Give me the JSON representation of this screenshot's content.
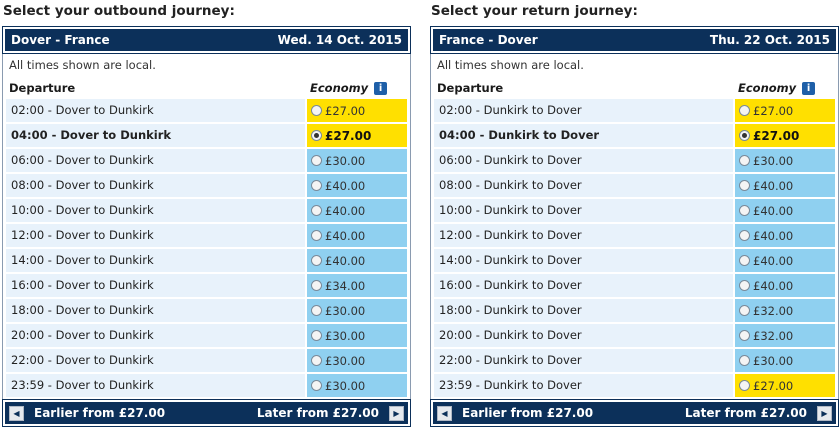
{
  "outbound": {
    "title": "Select your outbound journey:",
    "route": "Dover - France",
    "date": "Wed. 14 Oct. 2015",
    "note": "All times shown are local.",
    "col_departure": "Departure",
    "col_economy": "Economy",
    "rows": [
      {
        "time": "02:00 - Dover to Dunkirk",
        "price": "£27.00",
        "cheapest": true,
        "selected": false
      },
      {
        "time": "04:00 - Dover to Dunkirk",
        "price": "£27.00",
        "cheapest": true,
        "selected": true
      },
      {
        "time": "06:00 - Dover to Dunkirk",
        "price": "£30.00",
        "cheapest": false,
        "selected": false
      },
      {
        "time": "08:00 - Dover to Dunkirk",
        "price": "£40.00",
        "cheapest": false,
        "selected": false
      },
      {
        "time": "10:00 - Dover to Dunkirk",
        "price": "£40.00",
        "cheapest": false,
        "selected": false
      },
      {
        "time": "12:00 - Dover to Dunkirk",
        "price": "£40.00",
        "cheapest": false,
        "selected": false
      },
      {
        "time": "14:00 - Dover to Dunkirk",
        "price": "£40.00",
        "cheapest": false,
        "selected": false
      },
      {
        "time": "16:00 - Dover to Dunkirk",
        "price": "£34.00",
        "cheapest": false,
        "selected": false
      },
      {
        "time": "18:00 - Dover to Dunkirk",
        "price": "£30.00",
        "cheapest": false,
        "selected": false
      },
      {
        "time": "20:00 - Dover to Dunkirk",
        "price": "£30.00",
        "cheapest": false,
        "selected": false
      },
      {
        "time": "22:00 - Dover to Dunkirk",
        "price": "£30.00",
        "cheapest": false,
        "selected": false
      },
      {
        "time": "23:59 - Dover to Dunkirk",
        "price": "£30.00",
        "cheapest": false,
        "selected": false
      }
    ],
    "earlier": "Earlier from £27.00",
    "later": "Later from £27.00"
  },
  "return": {
    "title": "Select your return journey:",
    "route": "France - Dover",
    "date": "Thu. 22 Oct. 2015",
    "note": "All times shown are local.",
    "col_departure": "Departure",
    "col_economy": "Economy",
    "rows": [
      {
        "time": "02:00 - Dunkirk to Dover",
        "price": "£27.00",
        "cheapest": true,
        "selected": false
      },
      {
        "time": "04:00 - Dunkirk to Dover",
        "price": "£27.00",
        "cheapest": true,
        "selected": true
      },
      {
        "time": "06:00 - Dunkirk to Dover",
        "price": "£30.00",
        "cheapest": false,
        "selected": false
      },
      {
        "time": "08:00 - Dunkirk to Dover",
        "price": "£40.00",
        "cheapest": false,
        "selected": false
      },
      {
        "time": "10:00 - Dunkirk to Dover",
        "price": "£40.00",
        "cheapest": false,
        "selected": false
      },
      {
        "time": "12:00 - Dunkirk to Dover",
        "price": "£40.00",
        "cheapest": false,
        "selected": false
      },
      {
        "time": "14:00 - Dunkirk to Dover",
        "price": "£40.00",
        "cheapest": false,
        "selected": false
      },
      {
        "time": "16:00 - Dunkirk to Dover",
        "price": "£40.00",
        "cheapest": false,
        "selected": false
      },
      {
        "time": "18:00 - Dunkirk to Dover",
        "price": "£32.00",
        "cheapest": false,
        "selected": false
      },
      {
        "time": "20:00 - Dunkirk to Dover",
        "price": "£32.00",
        "cheapest": false,
        "selected": false
      },
      {
        "time": "22:00 - Dunkirk to Dover",
        "price": "£30.00",
        "cheapest": false,
        "selected": false
      },
      {
        "time": "23:59 - Dunkirk to Dover",
        "price": "£27.00",
        "cheapest": true,
        "selected": false
      }
    ],
    "earlier": "Earlier from £27.00",
    "later": "Later from £27.00"
  },
  "icons": {
    "info": "info-icon",
    "prev": "arrow-left-icon",
    "next": "arrow-right-icon"
  },
  "colors": {
    "header": "#0c305a",
    "cheapest": "#ffe000",
    "price": "#8fd0f0",
    "row": "#e8f2fb"
  }
}
